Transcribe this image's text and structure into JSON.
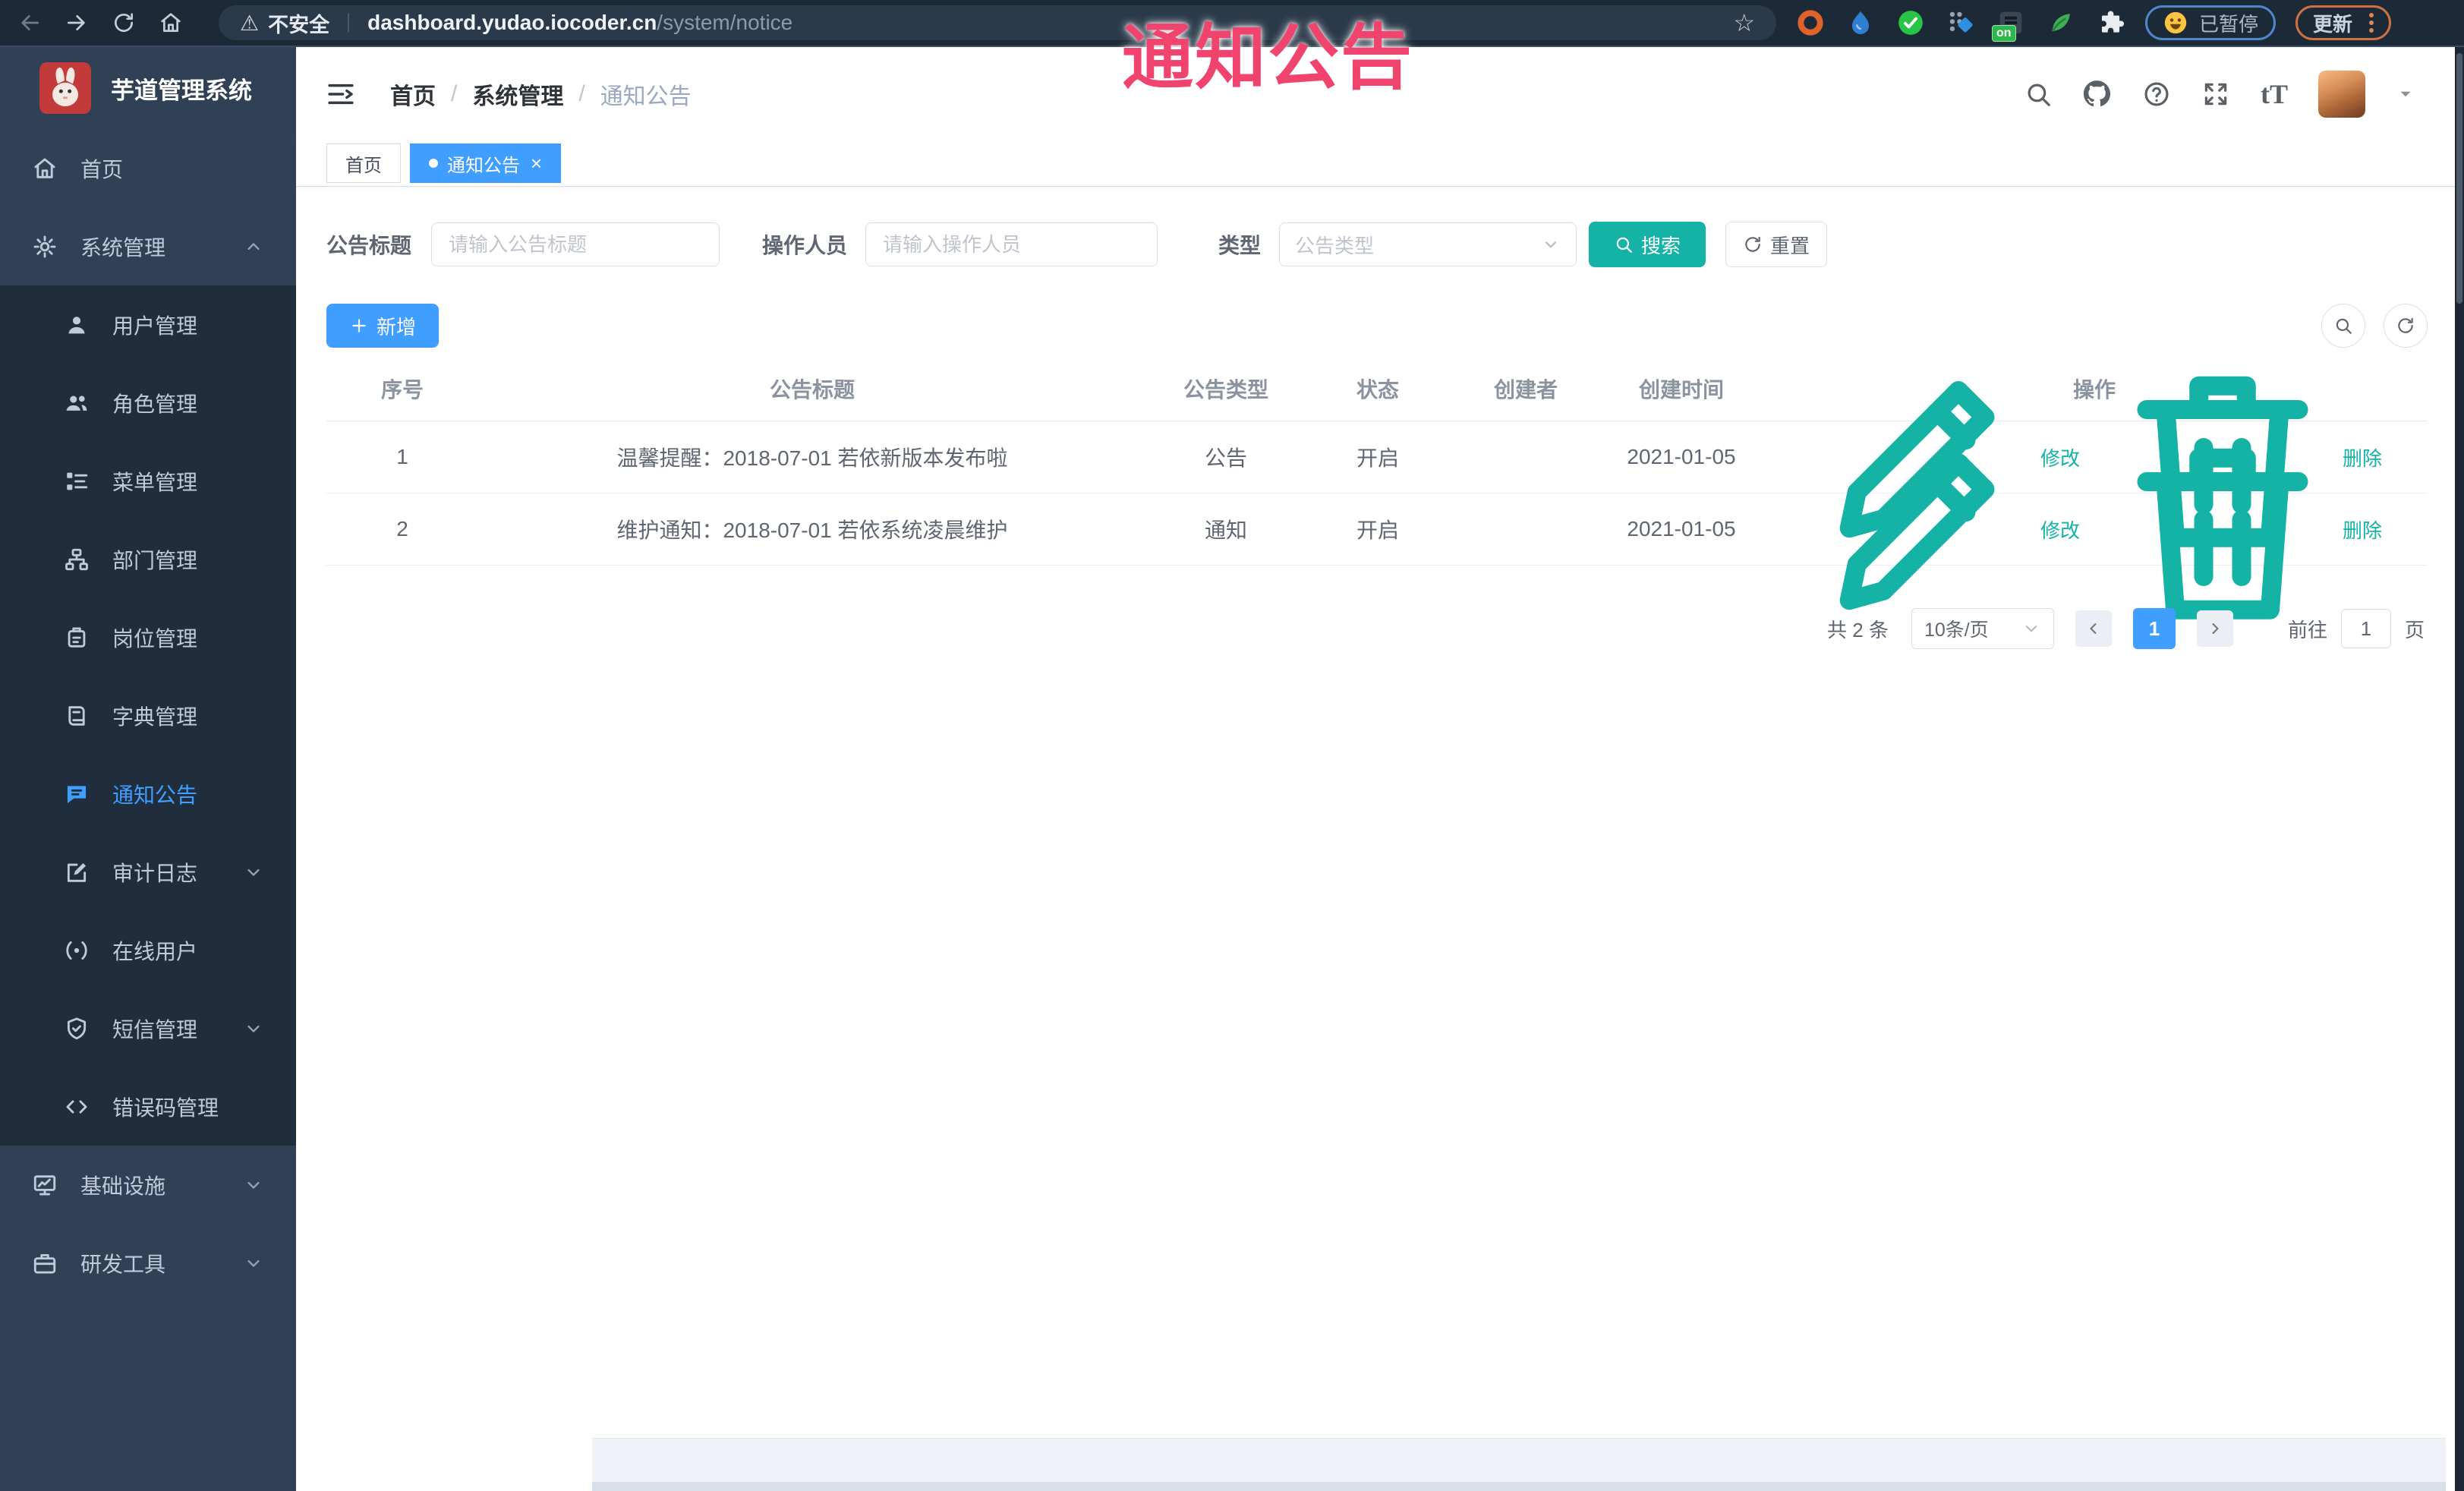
{
  "browser": {
    "security_label": "不安全",
    "url_domain": "dashboard.yudao.iocoder.cn",
    "url_path": "/system/notice",
    "extension_badge": "on",
    "paused_label": "已暂停",
    "update_label": "更新"
  },
  "watermark": "通知公告",
  "sidebar": {
    "title": "芋道管理系统",
    "items": [
      {
        "id": "home",
        "label": "首页",
        "icon": "home",
        "level": 1
      },
      {
        "id": "system-management",
        "label": "系统管理",
        "icon": "gear",
        "level": 1,
        "chevron": "up",
        "expanded": true
      },
      {
        "id": "user-management",
        "label": "用户管理",
        "icon": "user",
        "level": 2
      },
      {
        "id": "role-management",
        "label": "角色管理",
        "icon": "users",
        "level": 2
      },
      {
        "id": "menu-management",
        "label": "菜单管理",
        "icon": "menu",
        "level": 2
      },
      {
        "id": "dept-management",
        "label": "部门管理",
        "icon": "dept",
        "level": 2
      },
      {
        "id": "post-management",
        "label": "岗位管理",
        "icon": "post",
        "level": 2
      },
      {
        "id": "dict-management",
        "label": "字典管理",
        "icon": "dict",
        "level": 2
      },
      {
        "id": "notice",
        "label": "通知公告",
        "icon": "notice",
        "level": 2,
        "active": true
      },
      {
        "id": "audit-log",
        "label": "审计日志",
        "icon": "audit",
        "level": 2,
        "chevron": "down"
      },
      {
        "id": "online-users",
        "label": "在线用户",
        "icon": "online",
        "level": 2
      },
      {
        "id": "sms-management",
        "label": "短信管理",
        "icon": "sms",
        "level": 2,
        "chevron": "down"
      },
      {
        "id": "errcode-management",
        "label": "错误码管理",
        "icon": "code",
        "level": 2
      },
      {
        "id": "infrastructure",
        "label": "基础设施",
        "icon": "infra",
        "level": 1,
        "chevron": "down"
      },
      {
        "id": "dev-tools",
        "label": "研发工具",
        "icon": "tools",
        "level": 1,
        "chevron": "down"
      }
    ]
  },
  "breadcrumb": [
    "首页",
    "系统管理",
    "通知公告"
  ],
  "tabs": [
    {
      "id": "home",
      "label": "首页",
      "active": false,
      "closable": false
    },
    {
      "id": "notice",
      "label": "通知公告",
      "active": true,
      "closable": true
    }
  ],
  "filters": {
    "title_label": "公告标题",
    "title_placeholder": "请输入公告标题",
    "operator_label": "操作人员",
    "operator_placeholder": "请输入操作人员",
    "type_label": "类型",
    "type_placeholder": "公告类型",
    "search_label": "搜索",
    "reset_label": "重置"
  },
  "toolbar": {
    "add_label": "新增"
  },
  "table": {
    "headers": [
      "序号",
      "公告标题",
      "公告类型",
      "状态",
      "创建者",
      "创建时间",
      "操作"
    ],
    "rows": [
      {
        "no": "1",
        "title": "温馨提醒：2018-07-01 若依新版本发布啦",
        "type": "公告",
        "status": "开启",
        "creator": "",
        "created": "2021-01-05"
      },
      {
        "no": "2",
        "title": "维护通知：2018-07-01 若依系统凌晨维护",
        "type": "通知",
        "status": "开启",
        "creator": "",
        "created": "2021-01-05"
      }
    ],
    "ops": {
      "edit": "修改",
      "delete": "删除"
    }
  },
  "pagination": {
    "total": "共 2 条",
    "page_size": "10条/页",
    "current_page": "1",
    "goto_label": "前往",
    "goto_value": "1",
    "page_unit": "页"
  },
  "colors": {
    "primary": "#409eff",
    "teal": "#14b3a6",
    "watermark_pink": "#f0436e",
    "sidebar_bg": "#304156",
    "submenu_bg": "#1f2d3d"
  }
}
